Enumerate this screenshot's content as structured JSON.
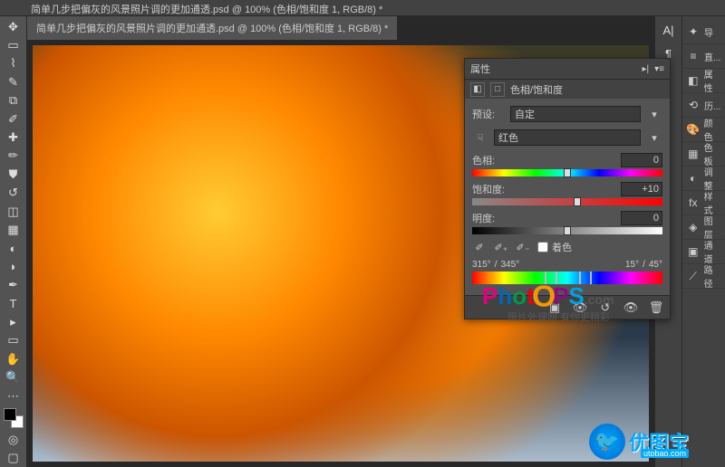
{
  "titlebar": "简单几步把偏灰的风景照片调的更加通透.psd @ 100% (色相/饱和度 1, RGB/8) *",
  "doc_tab": "简单几步把偏灰的风景照片调的更加通透.psd @ 100% (色相/饱和度 1, RGB/8) *",
  "properties": {
    "panel_title": "属性",
    "adjustment_name": "色相/饱和度",
    "preset_label": "预设:",
    "preset_value": "自定",
    "channel_value": "红色",
    "hue_label": "色相:",
    "hue_value": "0",
    "sat_label": "饱和度:",
    "sat_value": "+10",
    "lum_label": "明度:",
    "lum_value": "0",
    "colorize_label": "着色",
    "range_left_inner": "315°",
    "range_left_outer": "345°",
    "range_right_inner": "15°",
    "range_right_outer": "45°"
  },
  "right_panels": [
    {
      "icon": "✦",
      "label": "导"
    },
    {
      "icon": "≡",
      "label": "直..."
    },
    {
      "icon": "◧",
      "label": "属性"
    },
    {
      "icon": "⟲",
      "label": "历..."
    },
    {
      "icon": "🎨",
      "label": "颜色"
    },
    {
      "icon": "▦",
      "label": "色板"
    },
    {
      "icon": "◐",
      "label": "调整"
    },
    {
      "icon": "fx",
      "label": "样式"
    },
    {
      "icon": "◈",
      "label": "图层"
    },
    {
      "icon": "▣",
      "label": "通道"
    },
    {
      "icon": "⟋",
      "label": "路径"
    }
  ],
  "watermark1": {
    "text": "PhotOPS",
    "suffix": ".com",
    "sub": "照片处理网 有你更精彩"
  },
  "watermark2": {
    "text": "优图宝",
    "sub": "utobao.com"
  }
}
